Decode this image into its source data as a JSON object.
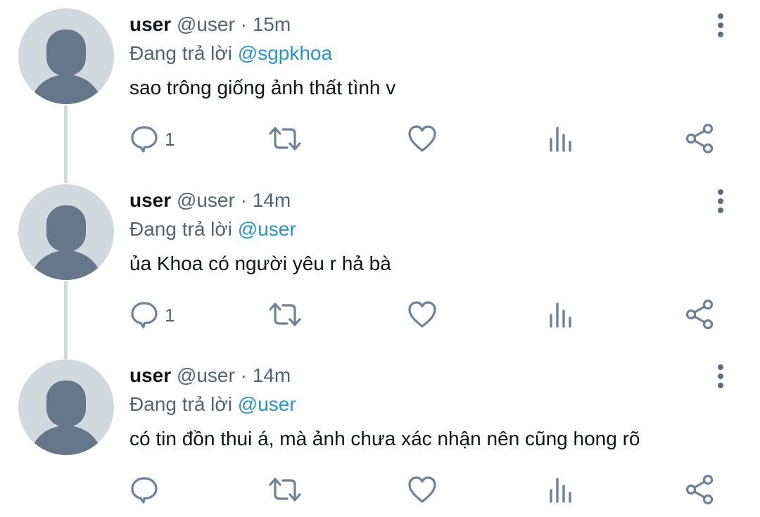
{
  "colors": {
    "text": "#0f1419",
    "secondary": "#536471",
    "mention": "#1d9bf0",
    "avatar_bg": "#cfd9de",
    "avatar_fg": "#66778a",
    "icon": "#6e8294"
  },
  "icons": {
    "more": "vertical-dots-icon",
    "reply": "speech-bubble-icon",
    "retweet": "retweet-icon",
    "like": "heart-icon",
    "views": "bar-chart-icon",
    "share": "share-icon"
  },
  "tweets": [
    {
      "name": "user",
      "handle": "@user",
      "separator": " · ",
      "time": "15m",
      "reply_prefix": "Đang trả lời ",
      "reply_to": "@sgpkhoa",
      "text": "sao trông giống ảnh thất tình v",
      "reply_count": "1"
    },
    {
      "name": "user",
      "handle": "@user",
      "separator": " · ",
      "time": "14m",
      "reply_prefix": "Đang trả lời ",
      "reply_to": "@user",
      "text": "ủa Khoa có người yêu r hả bà",
      "reply_count": "1"
    },
    {
      "name": "user",
      "handle": "@user",
      "separator": " · ",
      "time": "14m",
      "reply_prefix": "Đang trả lời ",
      "reply_to": "@user",
      "text": "có tin đồn thui á, mà ảnh chưa xác nhận nên cũng hong rõ",
      "reply_count": ""
    }
  ]
}
